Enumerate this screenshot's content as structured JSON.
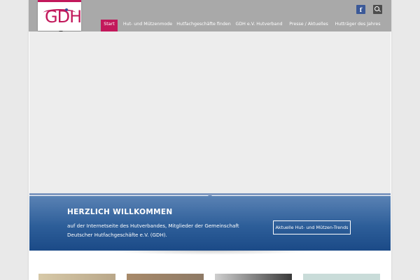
{
  "logo": {
    "text": "GDH"
  },
  "nav": {
    "items": [
      {
        "label": "Start",
        "active": true
      },
      {
        "label": "Hut- und Mützenmode",
        "active": false
      },
      {
        "label": "Hutfachgeschäfte finden",
        "active": false
      },
      {
        "label": "GDH e.V. Hutverband",
        "active": false
      },
      {
        "label": "Presse / Aktuelles",
        "active": false
      },
      {
        "label": "Hutträger des Jahres",
        "active": false
      }
    ]
  },
  "header": {
    "facebook_icon": "facebook-icon",
    "search_icon": "search-icon",
    "facebook_glyph": "f"
  },
  "welcome": {
    "title": "HERZLICH WILLKOMMEN",
    "line1": "auf der Internetseite des Hutverbandes, Mitglieder der Gemeinschaft",
    "line2": "Deutscher Hutfachgeschäfte e.V. (GDH).",
    "button_label": "Aktuelle Hut- und Mützen-Trends"
  },
  "colors": {
    "accent": "#c2185b",
    "topbar": "#a9a9a9",
    "welcome_blue": "#2d5e99",
    "facebook": "#3b5998"
  }
}
